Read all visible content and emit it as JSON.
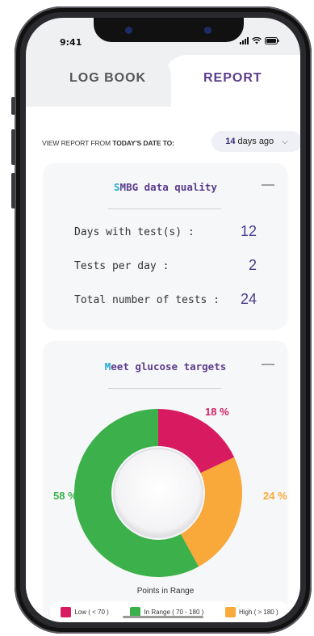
{
  "status_bar": {
    "time": "9:41"
  },
  "tabs": [
    {
      "label": "LOG BOOK",
      "active": false
    },
    {
      "label": "REPORT",
      "active": true
    }
  ],
  "filter": {
    "label_prefix": "VIEW REPORT FROM ",
    "label_bold": "TODAY'S DATE TO:",
    "select_number": "14",
    "select_text": " days ago"
  },
  "smbg_card": {
    "title_first": "S",
    "title_rest": "MBG data quality",
    "collapse_symbol": "—",
    "stats": [
      {
        "label": "Days with test(s) :",
        "value": "12"
      },
      {
        "label": "Tests per day :",
        "value": "2"
      },
      {
        "label": "Total number of tests :",
        "value": "24"
      }
    ]
  },
  "glucose_card": {
    "title_first": "M",
    "title_rest": "eet glucose targets",
    "collapse_symbol": "—",
    "caption": "Points in Range",
    "legend": [
      {
        "label": "Low ( < 70 )",
        "color": "#d81b60"
      },
      {
        "label": "In Range ( 70 - 180 )",
        "color": "#3cb04a"
      },
      {
        "label": "High ( > 180 )",
        "color": "#f9a83a"
      }
    ]
  },
  "chart_data": {
    "type": "pie",
    "title": "Meet glucose targets",
    "caption": "Points in Range",
    "slices": [
      {
        "name": "Low ( < 70 )",
        "value": 18,
        "label": "18 %",
        "color": "#d81b60"
      },
      {
        "name": "High ( > 180 )",
        "value": 24,
        "label": "24 %",
        "color": "#f9a83a"
      },
      {
        "name": "In Range ( 70 - 180 )",
        "value": 58,
        "label": "58 %",
        "color": "#3cb04a"
      }
    ],
    "donut": true
  }
}
